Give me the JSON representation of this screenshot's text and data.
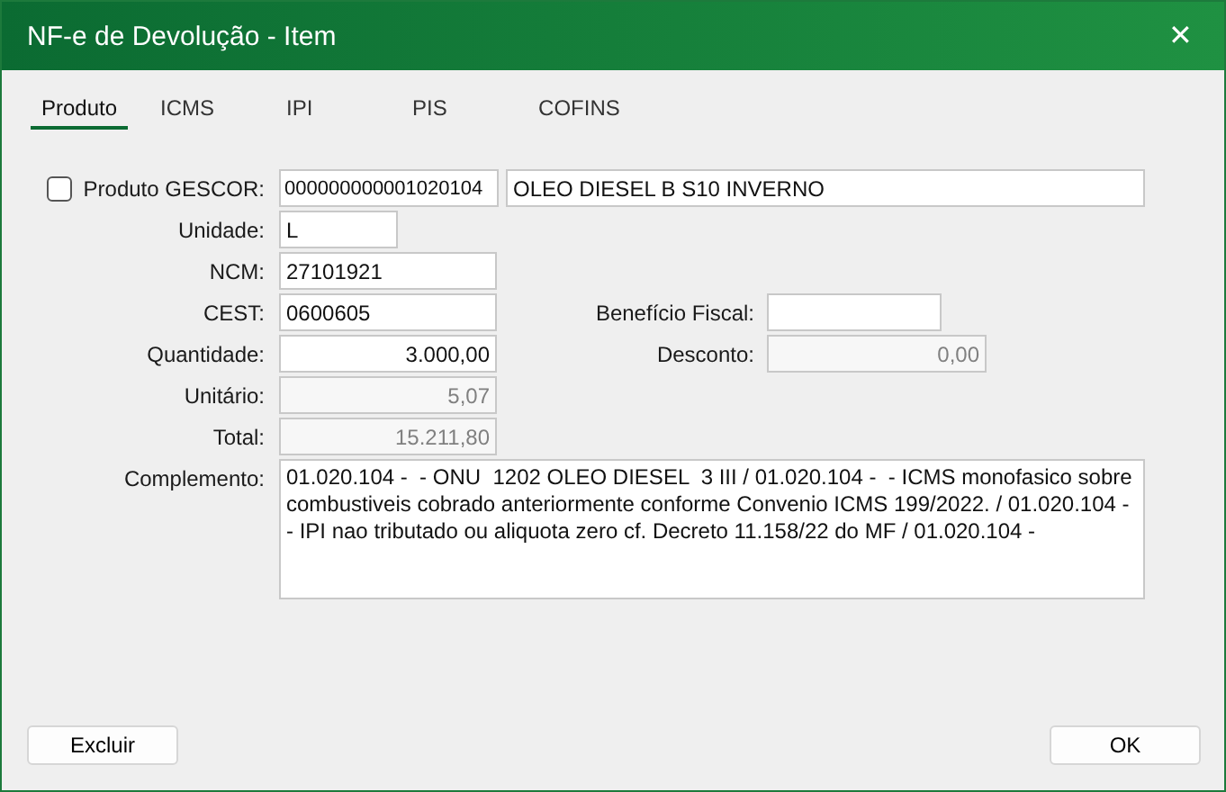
{
  "window": {
    "title": "NF-e de Devolução - Item",
    "close": "✕"
  },
  "tabs": [
    {
      "label": "Produto",
      "selected": true
    },
    {
      "label": "ICMS",
      "selected": false
    },
    {
      "label": "IPI",
      "selected": false
    },
    {
      "label": "PIS",
      "selected": false
    },
    {
      "label": "COFINS",
      "selected": false
    }
  ],
  "product": {
    "label": "Produto GESCOR:",
    "checked": false,
    "code": "000000000001020104",
    "description": "OLEO DIESEL B S10 INVERNO"
  },
  "fields": [
    {
      "label": "Unidade:",
      "value": "L",
      "kind": "text",
      "disabled": false
    },
    {
      "label": "NCM:",
      "value": "27101921",
      "kind": "text",
      "disabled": false
    },
    {
      "label": "CEST:",
      "value": "0600605",
      "kind": "text",
      "disabled": false,
      "side": {
        "label": "Benefício Fiscal:",
        "kind": "text"
      }
    },
    {
      "label": "Quantidade:",
      "value": "3.000,00",
      "kind": "number",
      "disabled": false,
      "side": {
        "label": "Desconto:",
        "value": "0,00",
        "kind": "number",
        "disabled": true
      }
    },
    {
      "label": "Unitário:",
      "value": "5,07",
      "kind": "number",
      "disabled": true
    },
    {
      "label": "Total:",
      "value": "15.211,80",
      "kind": "number",
      "disabled": true
    }
  ],
  "complement": {
    "label": "Complemento:",
    "value": "01.020.104 -  - ONU  1202 OLEO DIESEL  3 III / 01.020.104 -  - ICMS monofasico sobre combustiveis cobrado anteriormente conforme Convenio ICMS 199/2022. / 01.020.104 -  - IPI nao tributado ou aliquota zero cf. Decreto 11.158/22 do MF / 01.020.104 - "
  },
  "buttons": {
    "left": "Excluir",
    "right": "OK"
  }
}
